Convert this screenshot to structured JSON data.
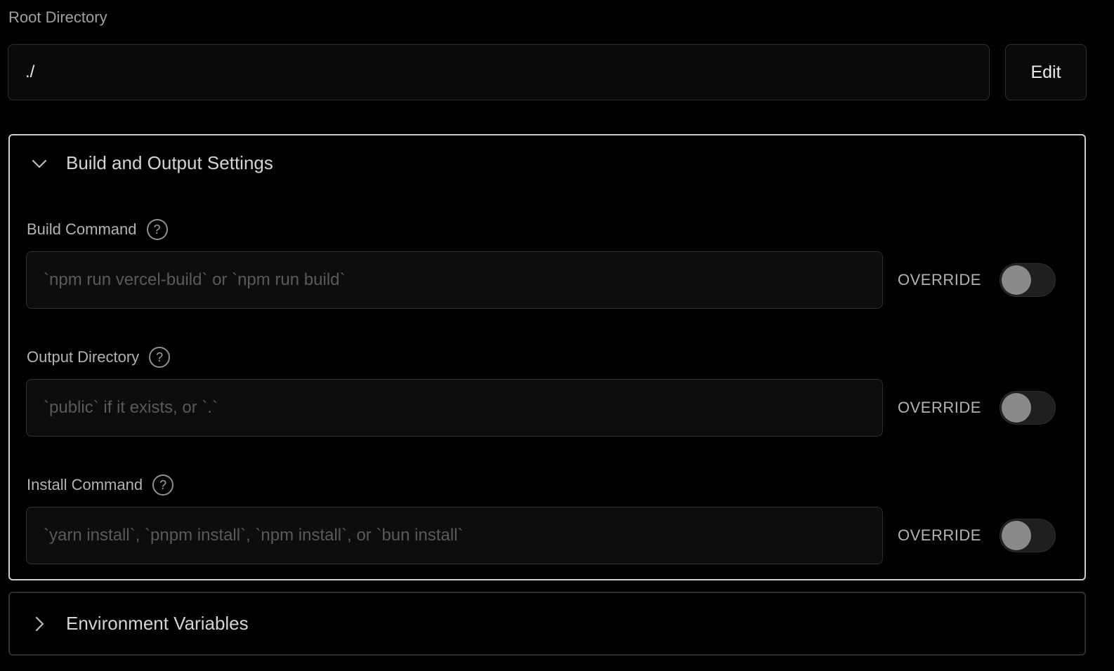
{
  "root_directory": {
    "label": "Root Directory",
    "value": "./",
    "edit_label": "Edit"
  },
  "build_settings": {
    "title": "Build and Output Settings",
    "expanded": true,
    "fields": [
      {
        "label": "Build Command",
        "placeholder": "`npm run vercel-build` or `npm run build`",
        "override_label": "OVERRIDE",
        "override": false
      },
      {
        "label": "Output Directory",
        "placeholder": "`public` if it exists, or `.`",
        "override_label": "OVERRIDE",
        "override": false
      },
      {
        "label": "Install Command",
        "placeholder": "`yarn install`, `pnpm install`, `npm install`, or `bun install`",
        "override_label": "OVERRIDE",
        "override": false
      }
    ]
  },
  "env_variables": {
    "title": "Environment Variables",
    "expanded": false
  },
  "icons": {
    "expand": "chevron-down-icon",
    "collapse": "chevron-right-icon",
    "help": "help-icon",
    "help_glyph": "?"
  },
  "colors": {
    "background": "#000000",
    "panel_border_active": "#cfcfcf",
    "panel_border": "#2e2e2e",
    "input_background": "#0d0d0d",
    "toggle_knob": "#8a8a8a"
  }
}
